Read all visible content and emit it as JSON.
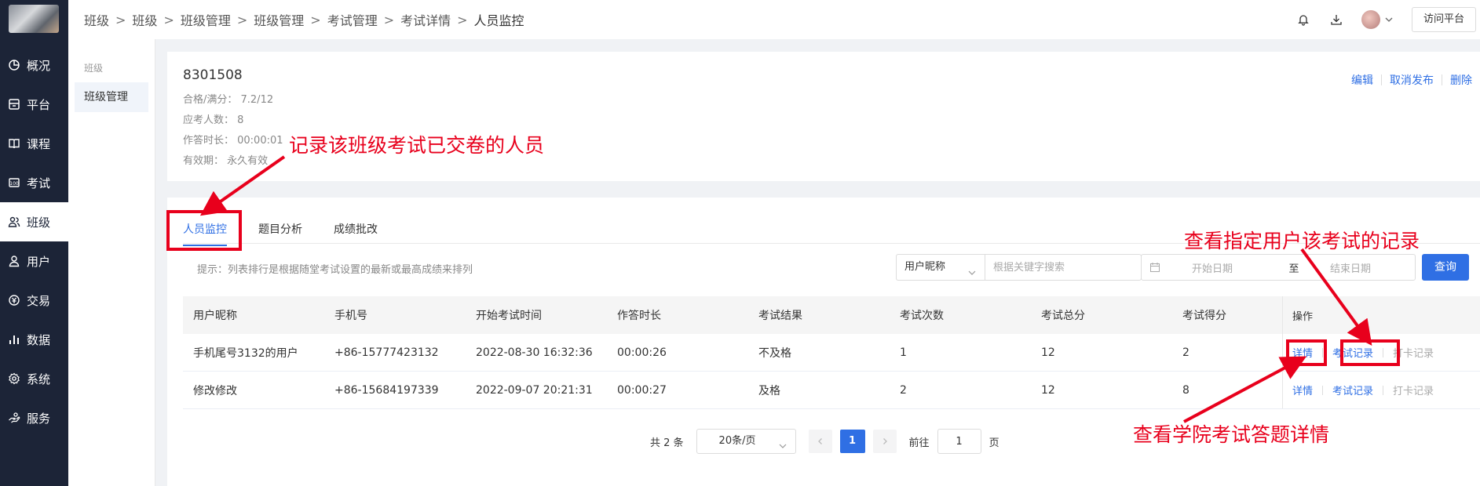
{
  "sidebar": {
    "items": [
      {
        "label": "概况",
        "icon": "pie-chart-icon"
      },
      {
        "label": "平台",
        "icon": "platform-icon"
      },
      {
        "label": "课程",
        "icon": "book-icon"
      },
      {
        "label": "考试",
        "icon": "exam-icon"
      },
      {
        "label": "班级",
        "icon": "users-icon",
        "active": true
      },
      {
        "label": "用户",
        "icon": "user-icon"
      },
      {
        "label": "交易",
        "icon": "transaction-icon"
      },
      {
        "label": "数据",
        "icon": "bar-chart-icon"
      },
      {
        "label": "系统",
        "icon": "gear-icon"
      },
      {
        "label": "服务",
        "icon": "service-icon"
      }
    ]
  },
  "subsidebar": {
    "group": "班级",
    "item": "班级管理"
  },
  "breadcrumb": [
    "班级",
    "班级",
    "班级管理",
    "班级管理",
    "考试管理",
    "考试详情",
    "人员监控"
  ],
  "topbar": {
    "visit_label": "访问平台"
  },
  "exam_info": {
    "title": "8301508",
    "pass_score": "合格/满分： 7.2/12",
    "expected": "应考人数： 8",
    "duration": "作答时长： 00:00:01",
    "validity": "有效期： 永久有效",
    "actions": [
      "编辑",
      "取消发布",
      "删除"
    ]
  },
  "tabs": [
    "人员监控",
    "题目分析",
    "成绩批改"
  ],
  "hint": "提示：列表排行是根据随堂考试设置的最新或最高成绩来排列",
  "filter": {
    "select_value": "用户昵称",
    "search_placeholder": "根据关键字搜索",
    "start_placeholder": "开始日期",
    "to_label": "至",
    "end_placeholder": "结束日期",
    "search_button": "查询"
  },
  "table": {
    "columns": [
      "用户昵称",
      "手机号",
      "开始考试时间",
      "作答时长",
      "考试结果",
      "考试次数",
      "考试总分",
      "考试得分",
      "操作"
    ],
    "rows": [
      {
        "name": "手机尾号3132的用户",
        "phone": "+86-15777423132",
        "start": "2022-08-30 16:32:36",
        "duration": "00:00:26",
        "result": "不及格",
        "attempts": "1",
        "total": "12",
        "score": "2"
      },
      {
        "name": "修改修改",
        "phone": "+86-15684197339",
        "start": "2022-09-07 20:21:31",
        "duration": "00:00:27",
        "result": "及格",
        "attempts": "2",
        "total": "12",
        "score": "8"
      }
    ],
    "ops": {
      "detail": "详情",
      "record": "考试记录",
      "checkin": "打卡记录"
    }
  },
  "pager": {
    "total": "共 2 条",
    "page_size": "20条/页",
    "current": "1",
    "goto_label": "前往",
    "goto_value": "1",
    "page_unit": "页"
  },
  "annotations": {
    "record_members": "记录该班级考试已交卷的人员",
    "view_record": "查看指定用户该考试的记录",
    "view_detail": "查看学院考试答题详情",
    "color": "#e8001c"
  }
}
